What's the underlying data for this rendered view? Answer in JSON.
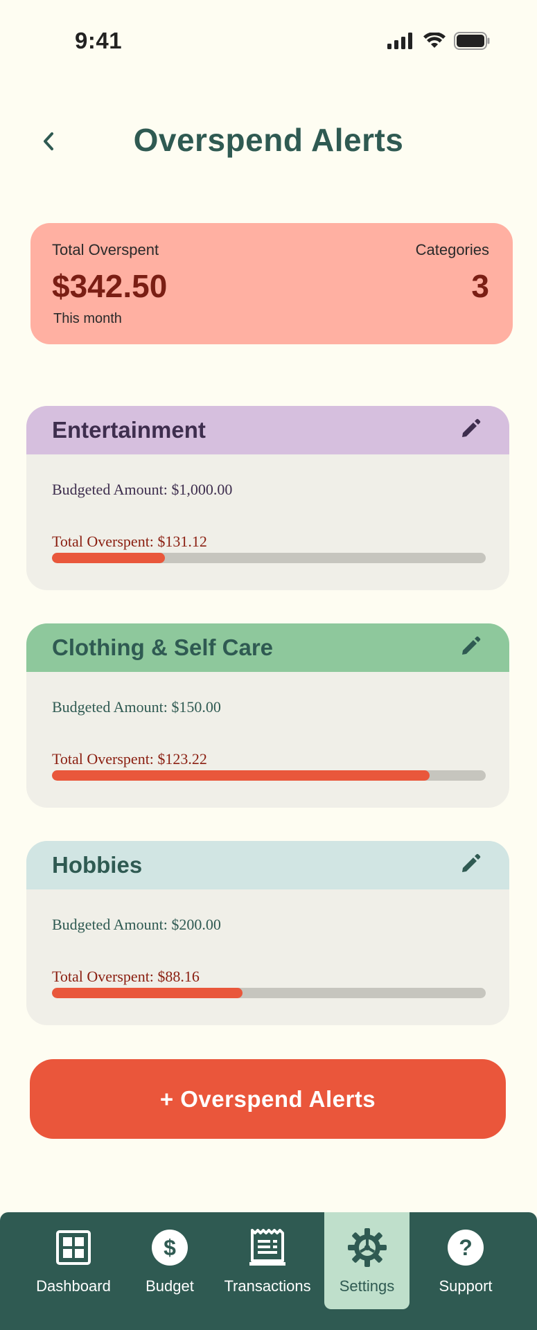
{
  "status_bar": {
    "time": "9:41"
  },
  "header": {
    "title": "Overspend Alerts"
  },
  "summary": {
    "total_label": "Total Overspent",
    "total_amount": "$342.50",
    "period": "This month",
    "categories_label": "Categories",
    "categories_count": "3"
  },
  "categories": [
    {
      "name": "Entertainment",
      "budgeted": "Budgeted Amount: $1,000.00",
      "overspent": "Total Overspent: $131.12",
      "progress_percent": 26,
      "header_color": "#D6BFDE",
      "text_color": "#3E2E4E"
    },
    {
      "name": "Clothing & Self Care",
      "budgeted": "Budgeted Amount: $150.00",
      "overspent": "Total Overspent: $123.22",
      "progress_percent": 87,
      "header_color": "#8EC89C",
      "text_color": "#2F5A52"
    },
    {
      "name": "Hobbies",
      "budgeted": "Budgeted Amount: $200.00",
      "overspent": "Total Overspent: $88.16",
      "progress_percent": 44,
      "header_color": "#D1E5E3",
      "text_color": "#2F5A52"
    }
  ],
  "add_button": {
    "label": "+ Overspend Alerts"
  },
  "nav": {
    "items": [
      {
        "label": "Dashboard",
        "icon": "dashboard-icon"
      },
      {
        "label": "Budget",
        "icon": "dollar-icon"
      },
      {
        "label": "Transactions",
        "icon": "receipt-icon"
      },
      {
        "label": "Settings",
        "icon": "gear-icon",
        "active": true
      },
      {
        "label": "Support",
        "icon": "help-icon"
      }
    ]
  },
  "colors": {
    "background": "#FEFDF2",
    "primary": "#2F5A52",
    "accent": "#EA563B",
    "summary_card": "#FFB0A2",
    "overspent_text": "#8A1E10"
  }
}
